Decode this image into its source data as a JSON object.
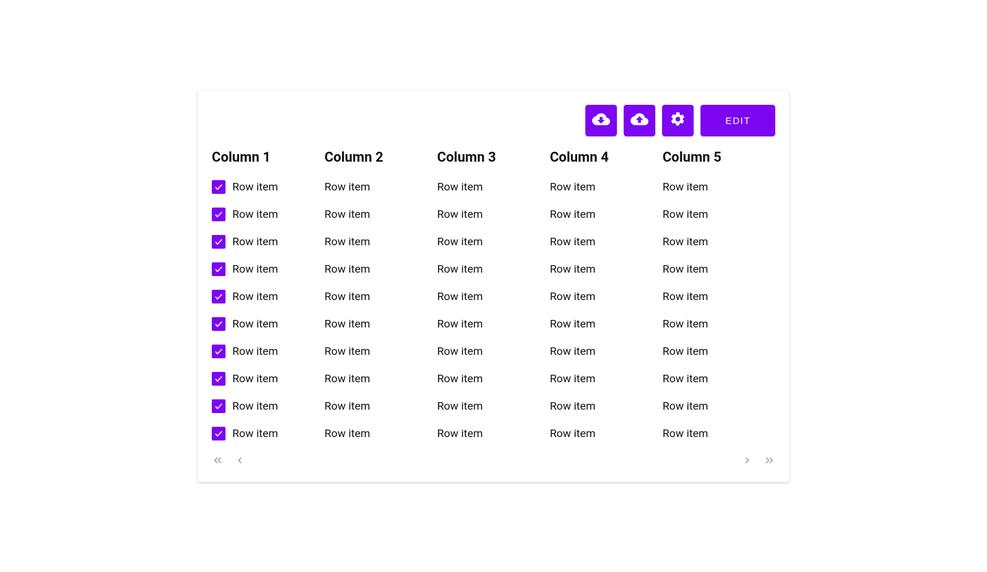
{
  "accent": "#7c05f2",
  "toolbar": {
    "edit_label": "EDIT"
  },
  "columns": [
    "Column 1",
    "Column 2",
    "Column 3",
    "Column 4",
    "Column 5"
  ],
  "rows": [
    {
      "checked": true,
      "cells": [
        "Row item",
        "Row item",
        "Row item",
        "Row item",
        "Row item"
      ]
    },
    {
      "checked": true,
      "cells": [
        "Row item",
        "Row item",
        "Row item",
        "Row item",
        "Row item"
      ]
    },
    {
      "checked": true,
      "cells": [
        "Row item",
        "Row item",
        "Row item",
        "Row item",
        "Row item"
      ]
    },
    {
      "checked": true,
      "cells": [
        "Row item",
        "Row item",
        "Row item",
        "Row item",
        "Row item"
      ]
    },
    {
      "checked": true,
      "cells": [
        "Row item",
        "Row item",
        "Row item",
        "Row item",
        "Row item"
      ]
    },
    {
      "checked": true,
      "cells": [
        "Row item",
        "Row item",
        "Row item",
        "Row item",
        "Row item"
      ]
    },
    {
      "checked": true,
      "cells": [
        "Row item",
        "Row item",
        "Row item",
        "Row item",
        "Row item"
      ]
    },
    {
      "checked": true,
      "cells": [
        "Row item",
        "Row item",
        "Row item",
        "Row item",
        "Row item"
      ]
    },
    {
      "checked": true,
      "cells": [
        "Row item",
        "Row item",
        "Row item",
        "Row item",
        "Row item"
      ]
    },
    {
      "checked": true,
      "cells": [
        "Row item",
        "Row item",
        "Row item",
        "Row item",
        "Row item"
      ]
    }
  ]
}
